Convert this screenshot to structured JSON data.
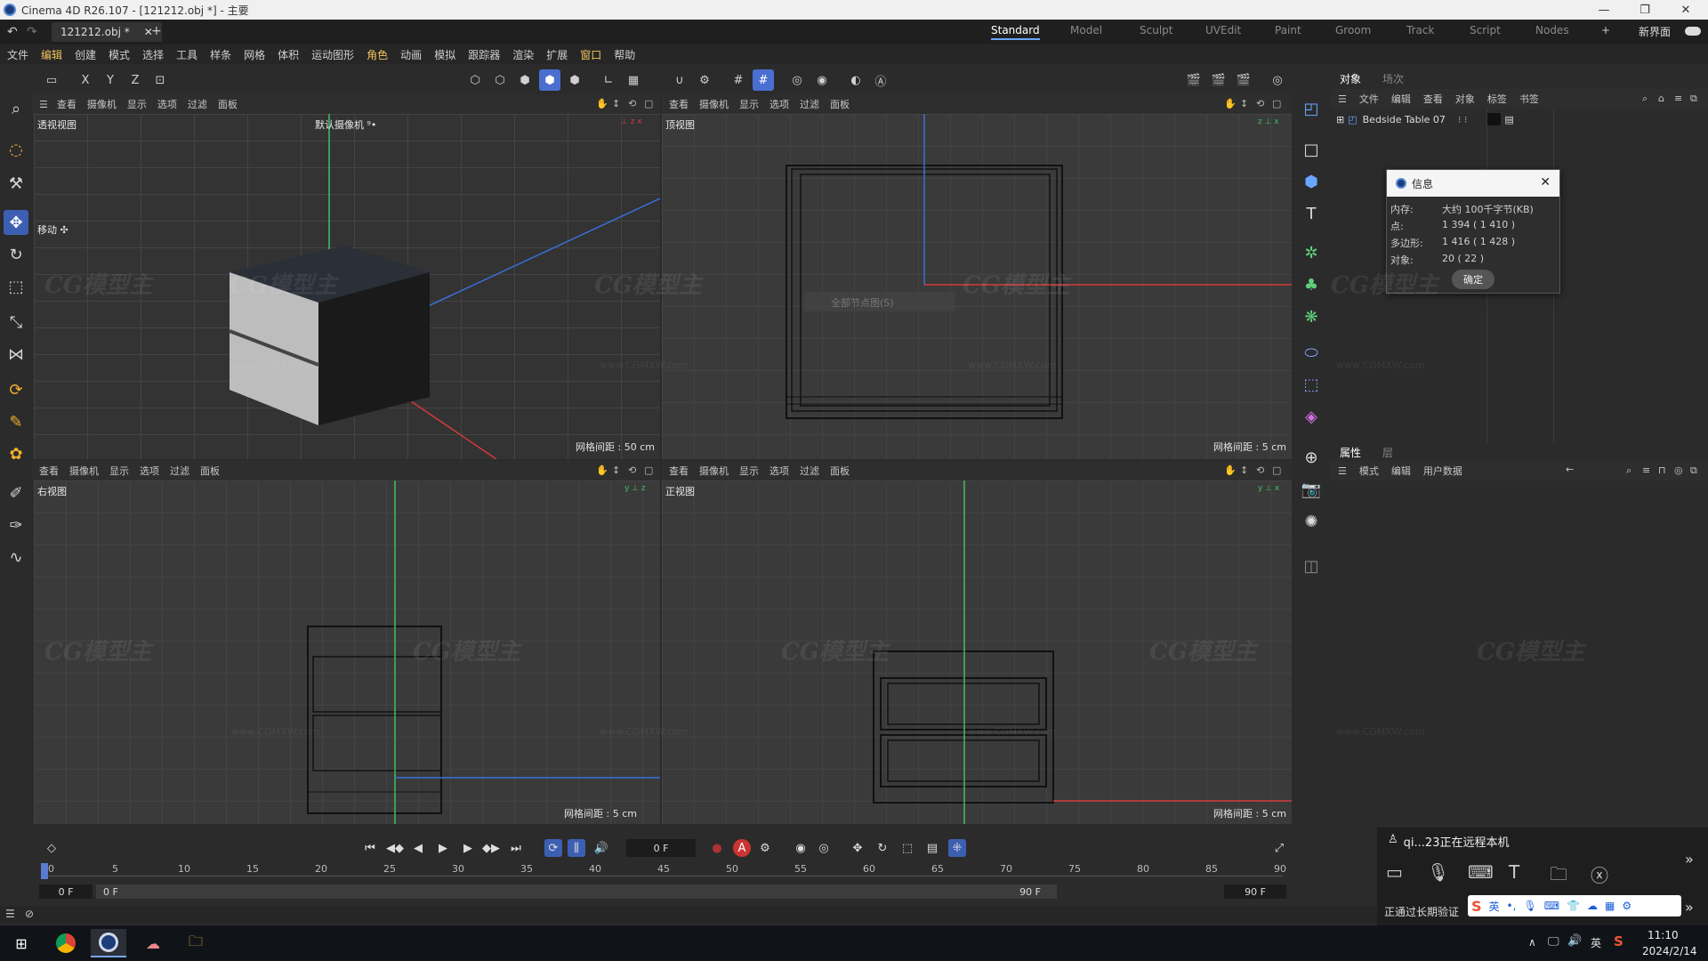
{
  "window": {
    "title": "Cinema 4D R26.107 - [121212.obj *] - 主要",
    "minimize": "—",
    "restore": "❐",
    "close": "✕"
  },
  "tabs": {
    "doc_tab": "121212.obj *",
    "add": "+"
  },
  "layouts": {
    "items": [
      "Standard",
      "Model",
      "Sculpt",
      "UVEdit",
      "Paint",
      "Groom",
      "Track",
      "Script",
      "Nodes"
    ],
    "add": "+",
    "new_interface": "新界面"
  },
  "menu": [
    "文件",
    "编辑",
    "创建",
    "模式",
    "选择",
    "工具",
    "样条",
    "网格",
    "体积",
    "运动图形",
    "角色",
    "动画",
    "模拟",
    "跟踪器",
    "渲染",
    "扩展",
    "窗口",
    "帮助"
  ],
  "toolbar": {
    "x": "X",
    "y": "Y",
    "z": "Z"
  },
  "viewports": {
    "menu_items": [
      "查看",
      "摄像机",
      "显示",
      "选项",
      "过滤",
      "面板"
    ],
    "perspective": {
      "name": "透视视图",
      "camera": "默认摄像机 ⁹•",
      "grid": "网格间距 : 50 cm",
      "move": "移动 ✣"
    },
    "top": {
      "name": "顶视图",
      "grid": "网格间距 : 5 cm",
      "ghost": "全部节点图(S)"
    },
    "right": {
      "name": "右视图",
      "grid": "网格间距 : 5 cm"
    },
    "front": {
      "name": "正视图",
      "grid": "网格间距 : 5 cm"
    }
  },
  "object_manager": {
    "tabs": [
      "对象",
      "场次"
    ],
    "menu": [
      "文件",
      "编辑",
      "查看",
      "对象",
      "标签",
      "书签"
    ],
    "object_name": "Bedside Table 07"
  },
  "info_dialog": {
    "title": "信息",
    "rows": [
      {
        "k": "内存:",
        "v": "大约 100千字节(KB)"
      },
      {
        "k": "点:",
        "v": "1 394 ( 1 410 )"
      },
      {
        "k": "多边形:",
        "v": "1 416 ( 1 428 )"
      },
      {
        "k": "对象:",
        "v": "20 ( 22 )"
      }
    ],
    "ok": "确定"
  },
  "attributes": {
    "tabs": [
      "属性",
      "层"
    ],
    "menu": [
      "模式",
      "编辑",
      "用户数据"
    ]
  },
  "timeline": {
    "frame_field": "0 F",
    "ticks": [
      "0",
      "5",
      "10",
      "15",
      "20",
      "25",
      "30",
      "35",
      "40",
      "45",
      "50",
      "55",
      "60",
      "65",
      "70",
      "75",
      "80",
      "85",
      "90"
    ],
    "start": "0 F",
    "current": "0 F",
    "end": "90 F",
    "end2": "90 F"
  },
  "remote": {
    "message": "qi...23正在远程本机",
    "status": "正通过长期验证",
    "lang": "英"
  },
  "taskbar": {
    "time": "11:10",
    "date": "2024/2/14",
    "ime": "英"
  },
  "watermark": {
    "logo": "CG模型主",
    "url": "www.CGMXW.com"
  },
  "colors": {
    "accent": "#4a6fd0",
    "axis_x": "#d23a3a",
    "axis_y": "#3fbf5f",
    "axis_z": "#3a6fd8"
  }
}
